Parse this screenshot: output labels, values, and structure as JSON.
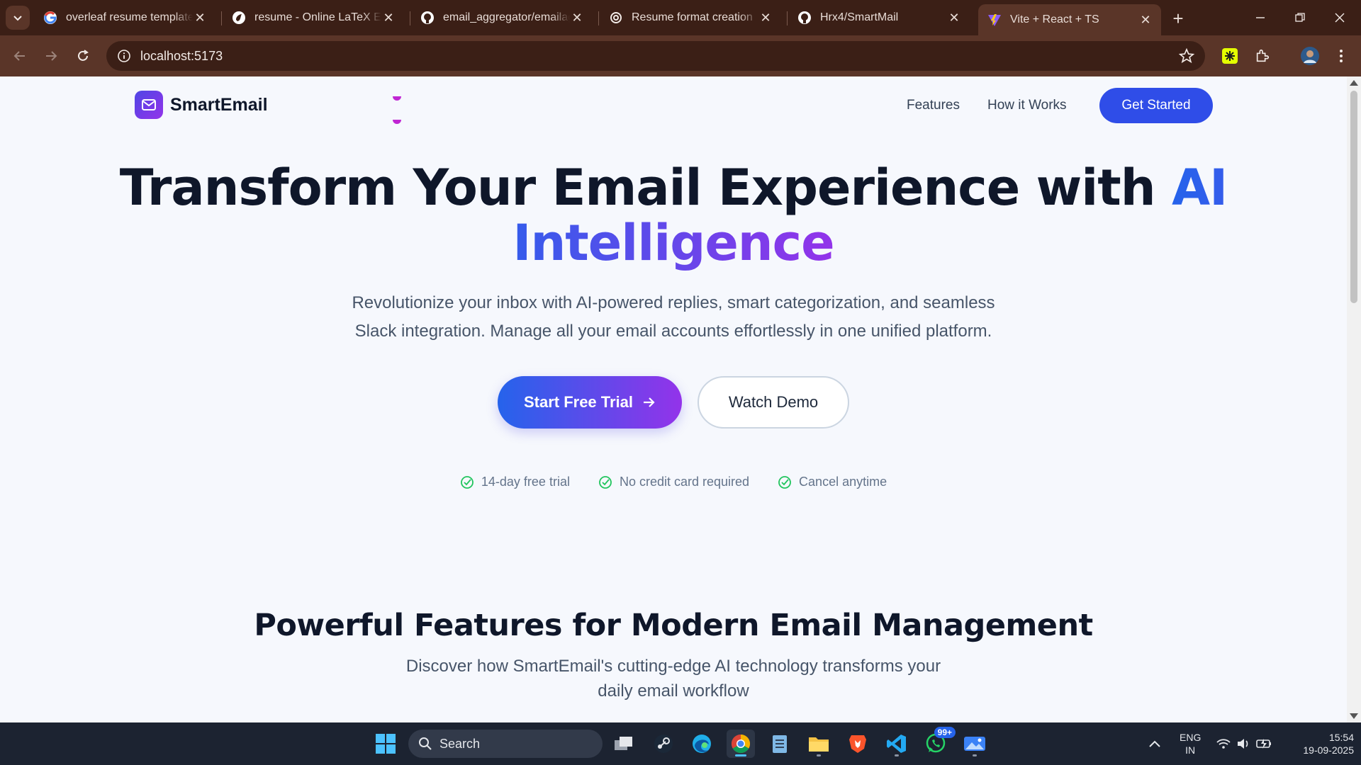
{
  "browser": {
    "tabs": [
      {
        "title": "overleaf resume templates",
        "icon": "google-icon",
        "active": false
      },
      {
        "title": "resume - Online LaTeX Editor",
        "icon": "overleaf-icon",
        "active": false
      },
      {
        "title": "email_aggregator/emailaggregator",
        "icon": "github-icon",
        "active": false
      },
      {
        "title": "Resume format creation",
        "icon": "openai-icon",
        "active": false
      },
      {
        "title": "Hrx4/SmartMail",
        "icon": "github-icon",
        "active": false
      },
      {
        "title": "Vite + React + TS",
        "icon": "vite-icon",
        "active": true
      }
    ],
    "url": "localhost:5173"
  },
  "site": {
    "brand": "SmartEmail",
    "nav": {
      "features": "Features",
      "how_it_works": "How it Works",
      "get_started": "Get Started"
    },
    "hero": {
      "title_part1": "Transform Your Email Experience with ",
      "title_part2": "AI Intelligence",
      "subtitle_line1": "Revolutionize your inbox with AI-powered replies, smart categorization, and seamless",
      "subtitle_line2": "Slack integration. Manage all your email accounts effortlessly in one unified platform.",
      "primary_cta": "Start Free Trial",
      "secondary_cta": "Watch Demo",
      "perks": [
        "14-day free trial",
        "No credit card required",
        "Cancel anytime"
      ]
    },
    "features": {
      "title": "Powerful Features for Modern Email Management",
      "subtitle_line1": "Discover how SmartEmail's cutting-edge AI technology transforms your",
      "subtitle_line2": "daily email workflow"
    },
    "colors": {
      "primary": "#2f4de8",
      "gradient_start": "#2563eb",
      "gradient_end": "#9333ea",
      "check": "#22c55e"
    }
  },
  "taskbar": {
    "search_placeholder": "Search",
    "whatsapp_badge": "99+",
    "language_line1": "ENG",
    "language_line2": "IN",
    "time": "15:54",
    "date": "19-09-2025"
  }
}
